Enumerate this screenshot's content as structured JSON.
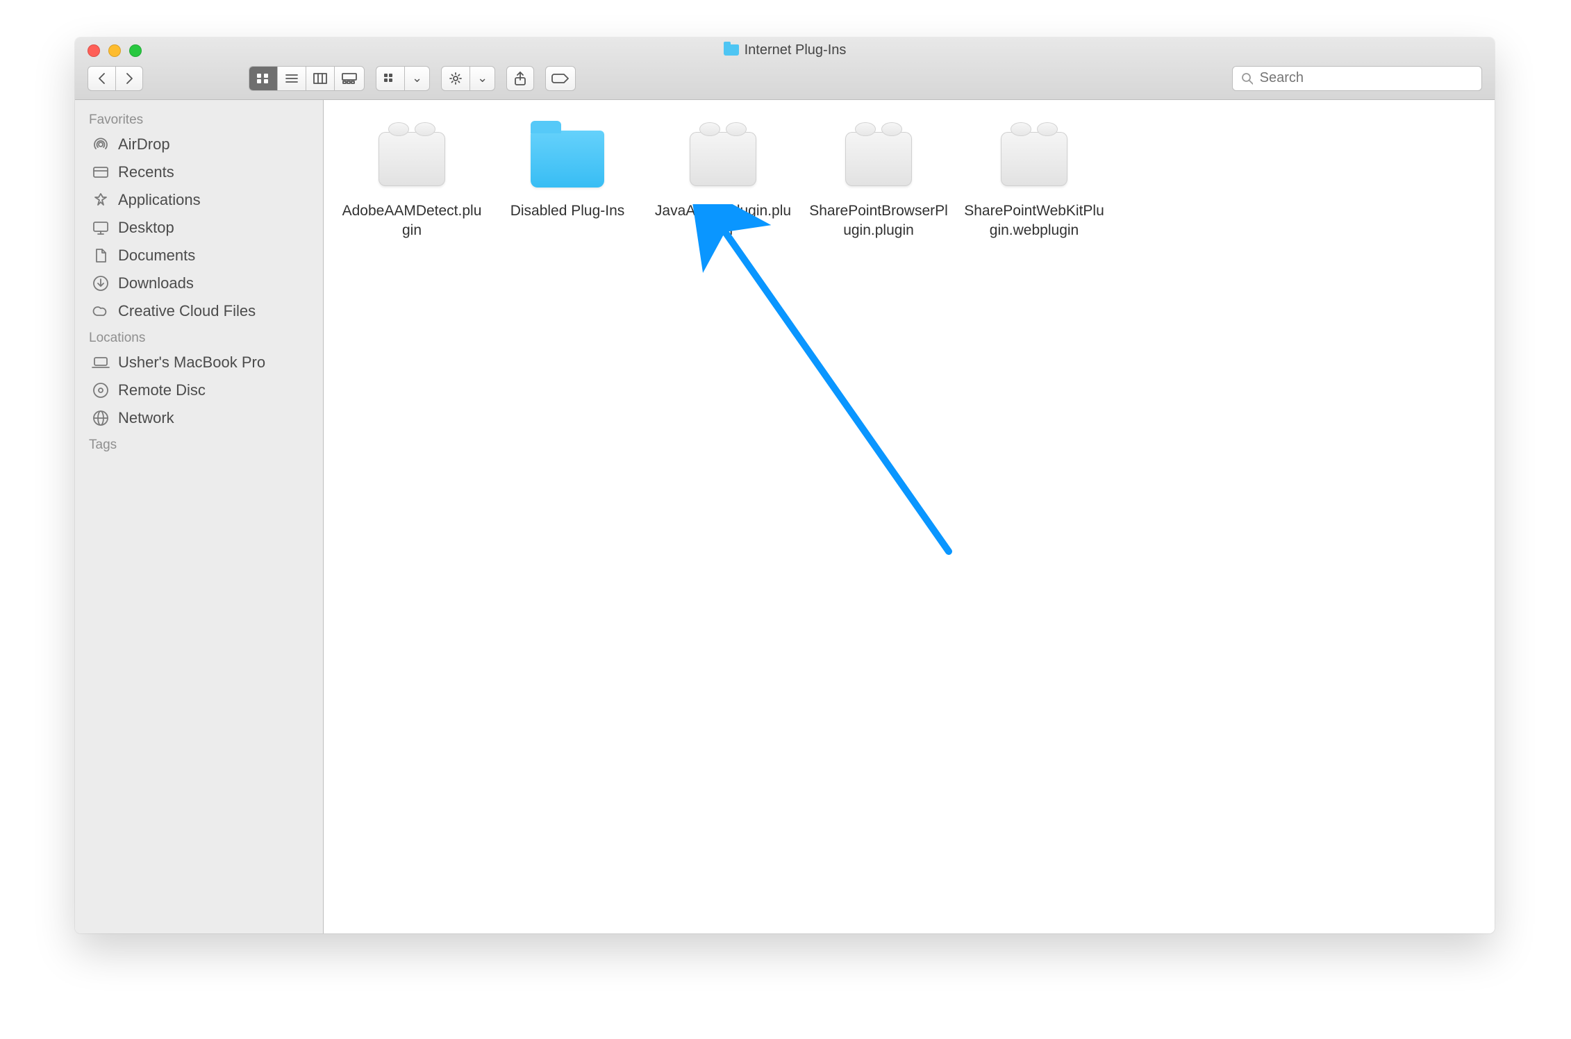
{
  "window": {
    "title": "Internet Plug-Ins"
  },
  "toolbar": {
    "search_placeholder": "Search"
  },
  "sidebar": {
    "sections": [
      {
        "header": "Favorites",
        "items": [
          {
            "icon": "airdrop",
            "label": "AirDrop"
          },
          {
            "icon": "recents",
            "label": "Recents"
          },
          {
            "icon": "applications",
            "label": "Applications"
          },
          {
            "icon": "desktop",
            "label": "Desktop"
          },
          {
            "icon": "documents",
            "label": "Documents"
          },
          {
            "icon": "downloads",
            "label": "Downloads"
          },
          {
            "icon": "creativecloud",
            "label": "Creative Cloud Files"
          }
        ]
      },
      {
        "header": "Locations",
        "items": [
          {
            "icon": "laptop",
            "label": "Usher's MacBook Pro"
          },
          {
            "icon": "disc",
            "label": "Remote Disc"
          },
          {
            "icon": "network",
            "label": "Network"
          }
        ]
      },
      {
        "header": "Tags",
        "items": []
      }
    ]
  },
  "files": [
    {
      "type": "plugin",
      "name": "AdobeAAMDetect.plugin"
    },
    {
      "type": "folder",
      "name": "Disabled Plug-Ins"
    },
    {
      "type": "plugin",
      "name": "JavaAppletPlugin.plugin"
    },
    {
      "type": "plugin",
      "name": "SharePointBrowserPlugin.plugin"
    },
    {
      "type": "plugin",
      "name": "SharePointWebKitPlugin.webplugin"
    }
  ],
  "annotation": {
    "color": "#0a96ff"
  }
}
